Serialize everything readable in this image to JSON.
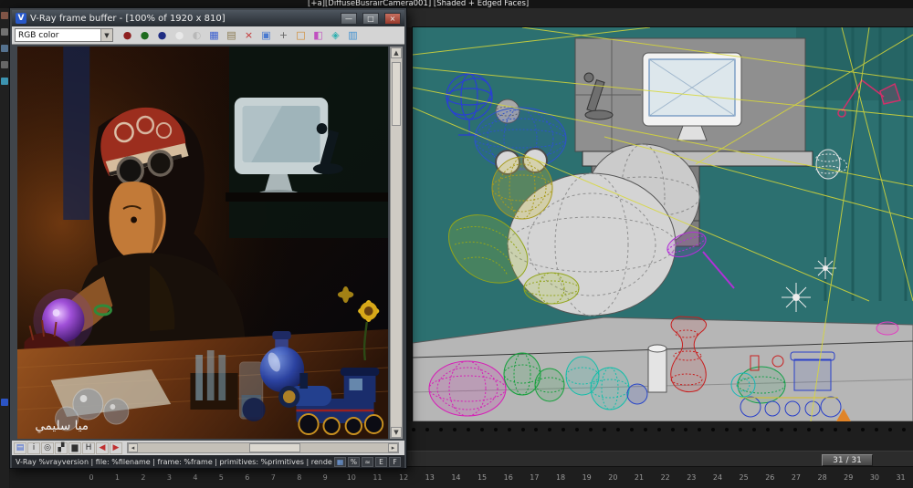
{
  "app": {
    "viewport_label": "[+a][DiffuseBusrairCamera001] [Shaded + Edged Faces]"
  },
  "icons": {
    "chevron_down": "▼",
    "scroll_up": "▲",
    "scroll_down": "▼",
    "scroll_left": "◂",
    "scroll_right": "▸"
  },
  "vfb": {
    "logo": "V",
    "title": "V-Ray frame buffer - [100% of 1920 x 810]",
    "window_buttons": {
      "minimize": "—",
      "maximize": "□",
      "close": "×"
    },
    "channel_dropdown": {
      "value": "RGB color"
    },
    "toolbar_icons": [
      {
        "name": "red-channel-icon",
        "glyph": "●",
        "color": "#8d1f1f"
      },
      {
        "name": "green-channel-icon",
        "glyph": "●",
        "color": "#1e6b1e"
      },
      {
        "name": "blue-channel-icon",
        "glyph": "●",
        "color": "#1f2d82"
      },
      {
        "name": "alpha-channel-icon",
        "glyph": "●",
        "color": "#e8e8e8"
      },
      {
        "name": "monochrome-icon",
        "glyph": "◐",
        "color": "#b8b8b8"
      },
      {
        "name": "save-image-icon",
        "glyph": "▦",
        "color": "#3a5fd0"
      },
      {
        "name": "load-image-icon",
        "glyph": "▤",
        "color": "#8a7a50"
      },
      {
        "name": "clear-image-icon",
        "glyph": "×",
        "color": "#c43030"
      },
      {
        "name": "duplicate-to-host-icon",
        "glyph": "▣",
        "color": "#4a7ad0"
      },
      {
        "name": "track-mouse-icon",
        "glyph": "+",
        "color": "#6a6a6a"
      },
      {
        "name": "region-render-icon",
        "glyph": "□",
        "color": "#d08a30"
      },
      {
        "name": "color-correction-icon",
        "glyph": "◧",
        "color": "#c050c0"
      },
      {
        "name": "pixel-info-icon",
        "glyph": "◈",
        "color": "#30b0b0"
      },
      {
        "name": "stamp-icon",
        "glyph": "▥",
        "color": "#3f90d0"
      }
    ],
    "bottom_icons": [
      {
        "name": "buffer-info-icon",
        "glyph": "▤",
        "color": "#3a5fd0"
      },
      {
        "name": "image-info-icon",
        "glyph": "i",
        "color": "#303030"
      },
      {
        "name": "zoom-tool-icon",
        "glyph": "◎",
        "color": "#303030"
      },
      {
        "name": "compare-icon",
        "glyph": "▞",
        "color": "#303030"
      },
      {
        "name": "histogram-icon",
        "glyph": "▆",
        "color": "#303030"
      },
      {
        "name": "h-channel-icon",
        "glyph": "H",
        "color": "#303030"
      },
      {
        "name": "prev-image-icon",
        "glyph": "◀",
        "color": "#c03030"
      },
      {
        "name": "next-image-icon",
        "glyph": "▶",
        "color": "#c03030"
      }
    ],
    "status_text": "V-Ray %vrayversion | file: %filename | frame: %frame | primitives: %primitives | render time: %rendertime",
    "status_icons": [
      {
        "name": "grid-toggle-icon",
        "glyph": "▦",
        "color": "#7ab0ff"
      },
      {
        "name": "percent-toggle-icon",
        "glyph": "%",
        "color": "#d8d8d8"
      },
      {
        "name": "curve-toggle-icon",
        "glyph": "≈",
        "color": "#d8d8d8"
      },
      {
        "name": "exposure-toggle-icon",
        "glyph": "E",
        "color": "#d8d8d8"
      },
      {
        "name": "filter-toggle-icon",
        "glyph": "F",
        "color": "#d8d8d8"
      }
    ],
    "watermark": "ميا سليمي"
  },
  "timeline": {
    "frames": [
      "0",
      "1",
      "2",
      "3",
      "4",
      "5",
      "6",
      "7",
      "8",
      "9",
      "10",
      "11",
      "12",
      "13",
      "14",
      "15",
      "16",
      "17",
      "18",
      "19",
      "20",
      "21",
      "22",
      "23",
      "24",
      "25",
      "26",
      "27",
      "28",
      "29",
      "30",
      "31"
    ],
    "current_frame_display": "31 / 31"
  },
  "left_strip": {
    "icons": [
      {
        "name": "side-tool-icon-1",
        "color": "#8a5a4a"
      },
      {
        "name": "side-tool-icon-2",
        "color": "#7a7a7a"
      },
      {
        "name": "side-tool-icon-3",
        "color": "#5a7a9a"
      },
      {
        "name": "side-tool-icon-4",
        "color": "#6f6f6f"
      },
      {
        "name": "side-tool-icon-5",
        "color": "#3fa0c0"
      },
      {
        "name": "vfb-taskbar-icon",
        "color": "#2e5ad6"
      }
    ]
  },
  "colors": {
    "viewport_background": "#2c7070",
    "ray_yellow": "#d8d838",
    "selection_yellow_green": "#93a51a",
    "timeline_background": "#1e1e1e"
  }
}
